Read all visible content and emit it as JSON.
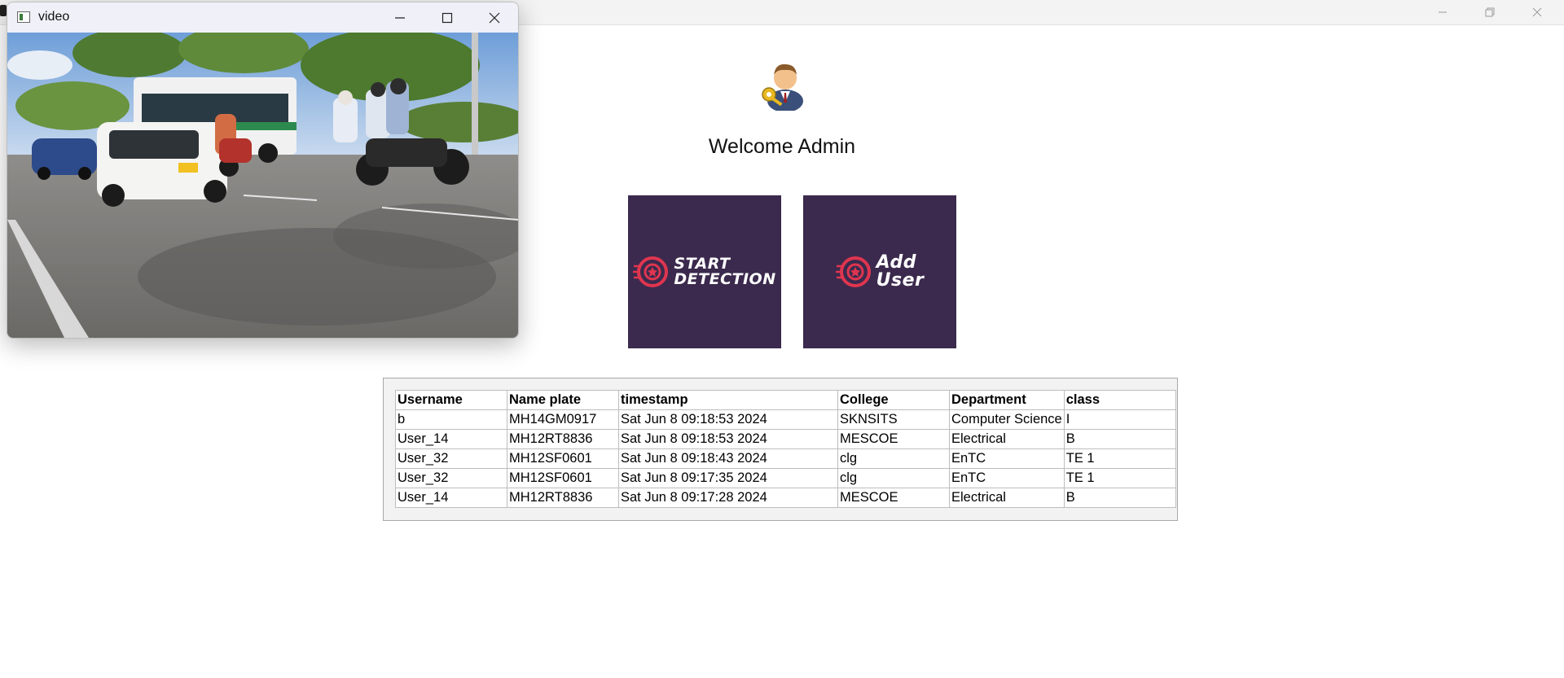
{
  "video_window": {
    "title": "video"
  },
  "main": {
    "welcome_text": "Welcome Admin",
    "start_tile": {
      "line1": "START",
      "line2": "DETECTION"
    },
    "add_tile": {
      "line1": "Add",
      "line2": "User"
    }
  },
  "table": {
    "columns": [
      "Username",
      "Name plate",
      "timestamp",
      "College",
      "Department",
      "class"
    ],
    "rows": [
      [
        "b",
        "MH14GM0917",
        "Sat Jun  8 09:18:53 2024",
        "SKNSITS",
        "Computer Science",
        "I"
      ],
      [
        "User_14",
        "MH12RT8836",
        "Sat Jun  8 09:18:53 2024",
        "MESCOE",
        "Electrical",
        "B"
      ],
      [
        "User_32",
        "MH12SF0601",
        "Sat Jun  8 09:18:43 2024",
        "clg",
        "EnTC",
        "TE 1"
      ],
      [
        "User_32",
        "MH12SF0601",
        "Sat Jun  8 09:17:35 2024",
        "clg",
        "EnTC",
        "TE 1"
      ],
      [
        "User_14",
        "MH12RT8836",
        "Sat Jun  8 09:17:28 2024",
        "MESCOE",
        "Electrical",
        "B"
      ]
    ]
  },
  "colors": {
    "tile_bg": "#3b2a4d",
    "tile_accent": "#e0354f"
  },
  "icons": [
    "minimize-icon",
    "maximize-icon",
    "restore-icon",
    "close-icon",
    "admin-avatar-icon",
    "wheel-icon"
  ]
}
